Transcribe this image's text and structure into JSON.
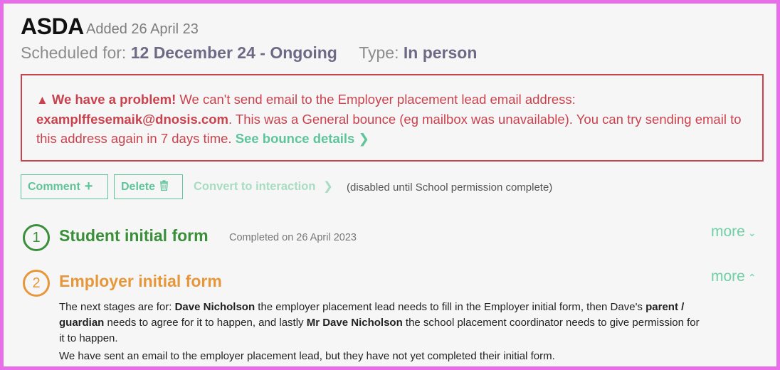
{
  "header": {
    "title": "ASDA",
    "added": "Added 26 April 23",
    "scheduled_label": "Scheduled for:",
    "scheduled_value": "12 December 24 - Ongoing",
    "type_label": "Type:",
    "type_value": "In person"
  },
  "alert": {
    "icon": "warning-triangle-icon",
    "heading": "We have a problem!",
    "text1": " We can't send email to the Employer placement lead email address: ",
    "email": "examplffesemaik@dnosis.com",
    "text2": ". This was a General bounce (eg mailbox was unavailable). You can try sending email to this address again in 7 days time. ",
    "link": "See bounce details",
    "color": "#c9424d"
  },
  "actions": {
    "comment_label": "Comment",
    "delete_label": "Delete",
    "convert_label": "Convert to interaction",
    "disabled_note": "(disabled until School permission complete)"
  },
  "steps": [
    {
      "number": "1",
      "title": "Student initial form",
      "meta": "Completed on 26 April 2023",
      "more": "more",
      "expanded": false,
      "color": "#3a8f3a"
    },
    {
      "number": "2",
      "title": "Employer initial form",
      "more": "more",
      "expanded": true,
      "color": "#e7963a",
      "para1": {
        "t1": "The next stages are for: ",
        "b1": "Dave Nicholson",
        "t2": " the employer placement lead needs to fill in the Employer initial form, then Dave's ",
        "b2": "parent / guardian",
        "t3": " needs to agree for it to happen, and lastly ",
        "b3": "Mr Dave Nicholson",
        "t4": " the school placement coordinator needs to give permission for it to happen."
      },
      "para2": "We have sent an email to the employer placement lead, but they have not yet completed their initial form."
    }
  ],
  "colors": {
    "accent_green": "#5ec59a",
    "border_frame": "#e76ee8"
  }
}
